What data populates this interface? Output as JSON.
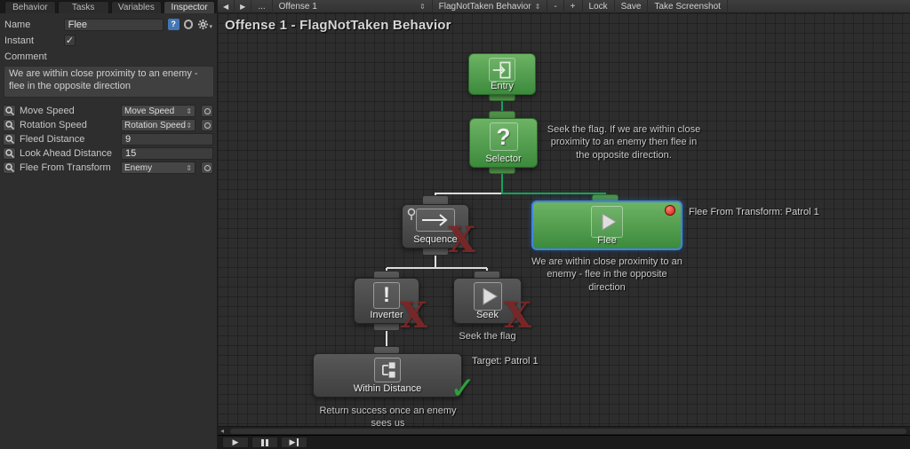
{
  "inspector": {
    "tabs": [
      "Behavior",
      "Tasks",
      "Variables",
      "Inspector"
    ],
    "active_tab": "Inspector",
    "name_label": "Name",
    "name_value": "Flee",
    "instant_label": "Instant",
    "instant_checked": true,
    "comment_label": "Comment",
    "comment_value": "We are within close proximity to an enemy - flee in the opposite direction",
    "variables": [
      {
        "label": "Move Speed",
        "value": "Move Speed",
        "control": "dropdown"
      },
      {
        "label": "Rotation Speed",
        "value": "Rotation Speed",
        "control": "dropdown"
      },
      {
        "label": "Fleed Distance",
        "value": "9",
        "control": "input"
      },
      {
        "label": "Look Ahead Distance",
        "value": "15",
        "control": "input"
      },
      {
        "label": "Flee From Transform",
        "value": "Enemy",
        "control": "dropdown"
      }
    ]
  },
  "toolbar": {
    "ellipsis": "...",
    "behavior_dropdown": "Offense 1",
    "tree_dropdown": "FlagNotTaken Behavior",
    "zoom_out": "-",
    "zoom_in": "+",
    "lock_label": "Lock",
    "save_label": "Save",
    "screenshot_label": "Take Screenshot"
  },
  "graph": {
    "title": "Offense 1 - FlagNotTaken Behavior",
    "entry_label": "Entry",
    "selector_label": "Selector",
    "selector_comment": "Seek the flag. If we are within close proximity to an enemy then flee in the opposite direction.",
    "sequence_label": "Sequence",
    "flee_label": "Flee",
    "flee_annotation": "Flee From Transform: Patrol 1",
    "flee_comment": "We are within close proximity to an enemy - flee in the opposite direction",
    "inverter_label": "Inverter",
    "seek_label": "Seek",
    "seek_comment": "Seek the flag",
    "within_distance_label": "Within Distance",
    "within_distance_annotation": "Target: Patrol 1",
    "within_distance_comment": "Return success once an enemy sees us"
  },
  "icons": {
    "prev": "◀",
    "next": "▶",
    "dropdown_arrows": "⇕",
    "help": "?",
    "check": "✓",
    "failure": "X",
    "success": "✓",
    "question": "?",
    "exclamation": "!",
    "play": "▶",
    "scroll_left": "◂",
    "caret": "▾"
  },
  "colors": {
    "node_green_top": "#6db364",
    "node_green_bottom": "#3c8a3c",
    "node_gray_top": "#585858",
    "node_gray_bottom": "#3f3f3f",
    "selection_border": "#3f84e0",
    "active_connection": "#12a35a",
    "inactive_connection": "#dcdcdc",
    "failure_red": "#7a2828",
    "success_green": "#2f9e3f",
    "breakpoint_red": "#cf1d10"
  }
}
